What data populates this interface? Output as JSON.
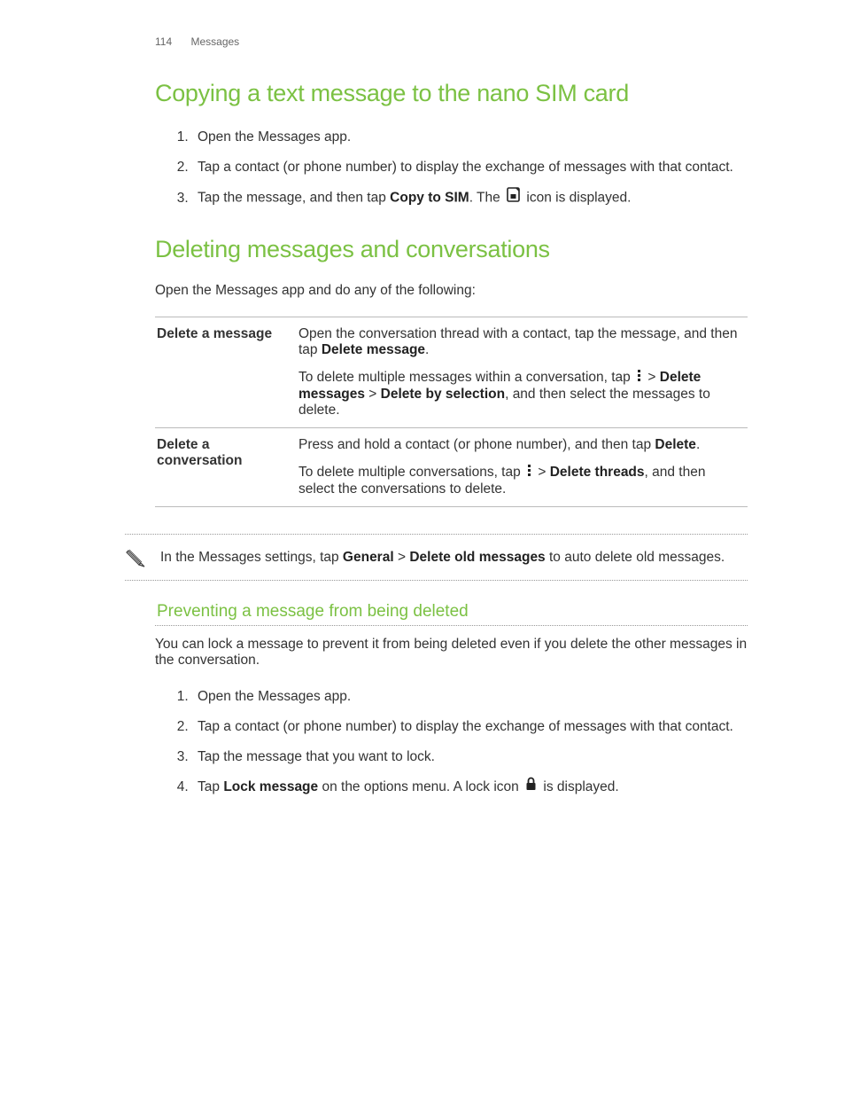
{
  "header": {
    "page_number": "114",
    "section": "Messages"
  },
  "section1": {
    "title": "Copying a text message to the nano SIM card",
    "steps": [
      {
        "text": "Open the Messages app."
      },
      {
        "text": "Tap a contact (or phone number) to display the exchange of messages with that contact."
      },
      {
        "pre": "Tap the message, and then tap ",
        "bold": "Copy to SIM",
        "post": ". The ",
        "tail": " icon is displayed."
      }
    ]
  },
  "section2": {
    "title": "Deleting messages and conversations",
    "intro": "Open the Messages app and do any of the following:",
    "rows": [
      {
        "label": "Delete a message",
        "p1a": "Open the conversation thread with a contact, tap the message, and then tap ",
        "p1b": "Delete message",
        "p1c": ".",
        "p2a": "To delete multiple messages within a conversation, tap ",
        "p2b": " > ",
        "p2c": "Delete messages",
        "p2d": " > ",
        "p2e": "Delete by selection",
        "p2f": ", and then select the messages to delete."
      },
      {
        "label": "Delete a conversation",
        "p1a": "Press and hold a contact (or phone number), and then tap ",
        "p1b": "Delete",
        "p1c": ".",
        "p2a": "To delete multiple conversations, tap ",
        "p2b": " > ",
        "p2c": "Delete threads",
        "p2d": ", and then select the conversations to delete."
      }
    ],
    "note_a": "In the Messages settings, tap ",
    "note_b": "General",
    "note_c": " > ",
    "note_d": "Delete old messages",
    "note_e": " to auto delete old messages."
  },
  "section3": {
    "title": "Preventing a message from being deleted",
    "intro": "You can lock a message to prevent it from being deleted even if you delete the other messages in the conversation.",
    "steps": [
      {
        "text": "Open the Messages app."
      },
      {
        "text": "Tap a contact (or phone number) to display the exchange of messages with that contact."
      },
      {
        "text": "Tap the message that you want to lock."
      },
      {
        "pre": "Tap ",
        "bold": "Lock message",
        "post": " on the options menu. A lock icon ",
        "tail": " is displayed."
      }
    ]
  }
}
